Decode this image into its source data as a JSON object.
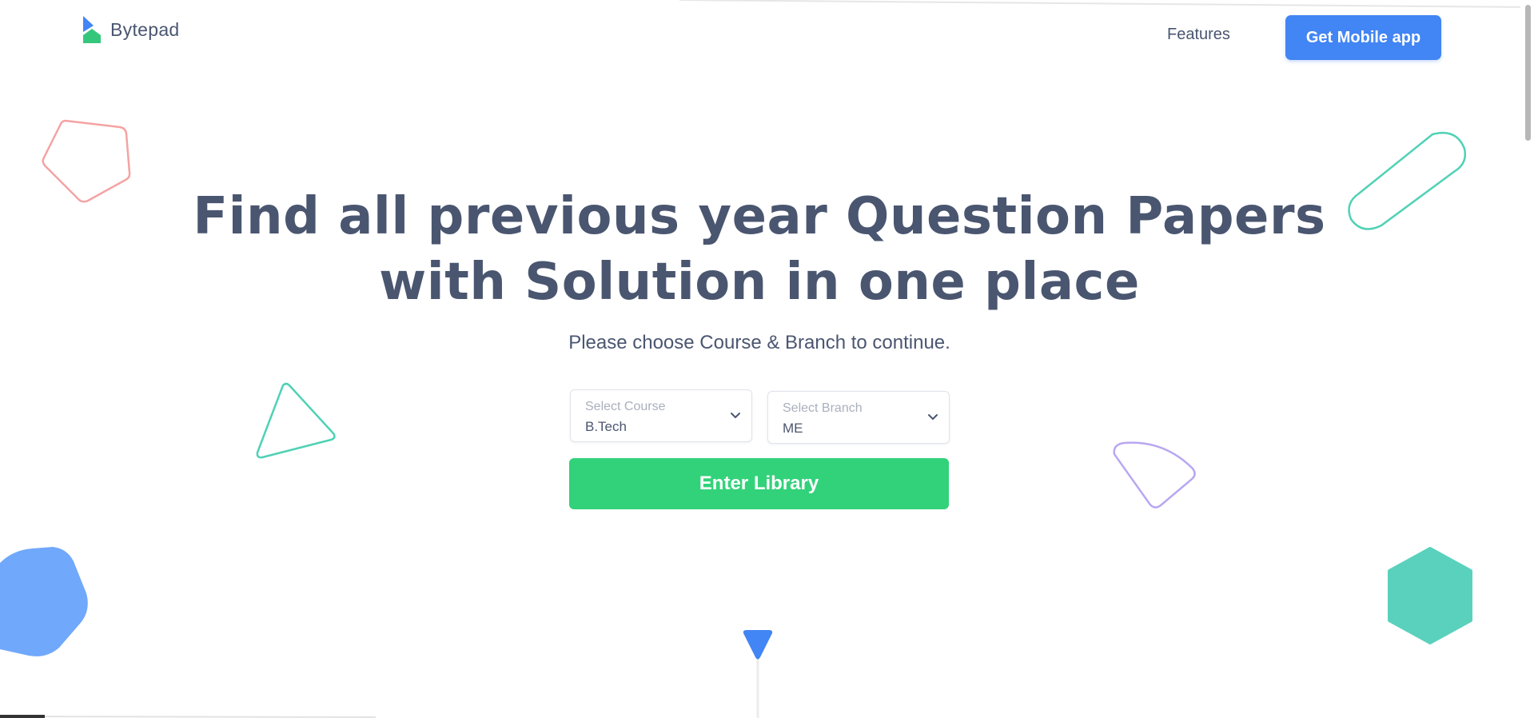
{
  "header": {
    "brand": "Bytepad",
    "nav_features": "Features",
    "cta_label": "Get Mobile app"
  },
  "hero": {
    "title_line1": "Find all previous year Question Papers",
    "title_line2": "with Solution in one place",
    "subtitle": "Please choose Course & Branch to continue."
  },
  "form": {
    "course": {
      "label": "Select Course",
      "value": "B.Tech"
    },
    "branch": {
      "label": "Select Branch",
      "value": "ME"
    },
    "submit_label": "Enter Library"
  },
  "colors": {
    "primary": "#4285f4",
    "success": "#32d27a",
    "text": "#4a5670",
    "muted": "#a9b0bd",
    "shape_red": "#f4a3a3",
    "shape_teal": "#4fd1b5",
    "shape_purple": "#b9a7f2",
    "shape_blue": "#70a8fb",
    "shape_green": "#5ad1bc"
  },
  "icons": [
    "bytepad-logo",
    "chevron-down-icon",
    "scroll-down-icon"
  ]
}
